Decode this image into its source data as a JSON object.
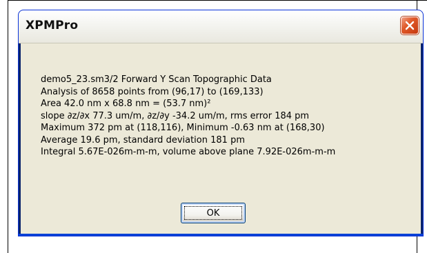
{
  "window": {
    "title": "XPMPro"
  },
  "message_lines": [
    "demo5_23.sm3/2 Forward Y Scan Topographic Data",
    "Analysis of 8658 points from (96,17) to (169,133)",
    "Area 42.0 nm x 68.8 nm = (53.7 nm)²",
    "slope ∂z/∂x 77.3 um/m, ∂z/∂y -34.2 um/m, rms error 184 pm",
    "Maximum 372 pm at (118,116), Minimum -0.63 nm at (168,30)",
    "Average 19.6 pm, standard deviation 181 pm",
    "Integral 5.67E-026m-m-m, volume above plane 7.92E-026m-m-m"
  ],
  "buttons": {
    "ok_label": "OK"
  },
  "icons": {
    "close": "close-icon"
  },
  "colors": {
    "dialog_background": "#ece9d8",
    "close_button": "#e05a2a",
    "window_frame": "#0842d6"
  }
}
